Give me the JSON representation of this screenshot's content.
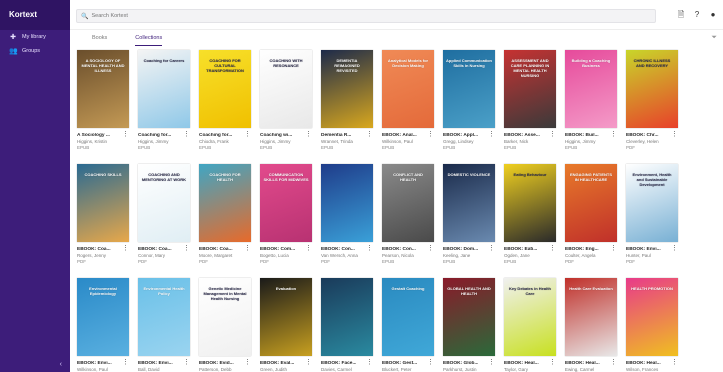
{
  "app": {
    "brand": "Kortext"
  },
  "sidebar": {
    "items": [
      {
        "label": "My library",
        "icon": "library-icon"
      },
      {
        "label": "Groups",
        "icon": "groups-icon"
      }
    ],
    "collapse_icon": "chevron-left-icon"
  },
  "search": {
    "placeholder": "Search Kortext",
    "value": ""
  },
  "header_icons": [
    "bookmark-icon",
    "help-icon",
    "account-icon"
  ],
  "tabs": [
    {
      "label": "Books",
      "active": false
    },
    {
      "label": "Collections",
      "active": true
    }
  ],
  "filter_icon": "filter-icon",
  "books": [
    {
      "title": "A Sociology ...",
      "author": "Higgins, Kristin",
      "format": "EPUB",
      "cover": "A SOCIOLOGY OF MENTAL HEALTH AND ILLNESS",
      "c1": "#6a4e2c",
      "c2": "#c49a55"
    },
    {
      "title": "Coaching for...",
      "author": "Higgins, Jimmy",
      "format": "EPUB",
      "cover": "Coaching for Careers",
      "c1": "#f4f4f4",
      "c2": "#8fc8e8"
    },
    {
      "title": "Coaching for...",
      "author": "Chiodra, Frank",
      "format": "EPUB",
      "cover": "COACHING FOR CULTURAL TRANSFORMATION",
      "c1": "#f7e02a",
      "c2": "#f0c000"
    },
    {
      "title": "Coaching wi...",
      "author": "Higgins, Jimmy",
      "format": "EPUB",
      "cover": "COACHING WITH RESONANCE",
      "c1": "#ffffff",
      "c2": "#e8e8e8"
    },
    {
      "title": "Dementia R...",
      "author": "Wrannet, Trinda",
      "format": "EPUB",
      "cover": "DEMENTIA REIMAGINED REVISITED",
      "c1": "#1d2a4a",
      "c2": "#d9a81e"
    },
    {
      "title": "EBOOK: Anal...",
      "author": "Wilkinson, Paul",
      "format": "EPUB",
      "cover": "Analytical Models for Decision Making",
      "c1": "#f08a56",
      "c2": "#e46a3a"
    },
    {
      "title": "EBOOK: Appl...",
      "author": "Gregg, Lindsey",
      "format": "EPUB",
      "cover": "Applied Communication Skills in Nursing",
      "c1": "#1f6ea0",
      "c2": "#4ba0c8"
    },
    {
      "title": "EBOOK: Asse...",
      "author": "Barker, Nick",
      "format": "EPUB",
      "cover": "ASSESSMENT AND CARE PLANNING IN MENTAL HEALTH NURSING",
      "c1": "#c63232",
      "c2": "#3a3a3a"
    },
    {
      "title": "EBOOK: Buil...",
      "author": "Higgins, Jimmy",
      "format": "EPUB",
      "cover": "Building a Coaching Business",
      "c1": "#e64a9b",
      "c2": "#f49bc8"
    },
    {
      "title": "EBOOK: Chr...",
      "author": "Cleverley, Helen",
      "format": "PDF",
      "cover": "CHRONIC ILLNESS AND RECOVERY",
      "c1": "#c8d62a",
      "c2": "#e8402a"
    },
    {
      "title": "EBOOK: Coa...",
      "author": "Rogers, Jenny",
      "format": "PDF",
      "cover": "COACHING SKILLS",
      "c1": "#2a6a92",
      "c2": "#e8a84a"
    },
    {
      "title": "EBOOK: Coa...",
      "author": "Connor, Mary",
      "format": "PDF",
      "cover": "COACHING AND MENTORING AT WORK",
      "c1": "#ffffff",
      "c2": "#e0eef4"
    },
    {
      "title": "EBOOK: Coa...",
      "author": "Moore, Margaret",
      "format": "PDF",
      "cover": "COACHING FOR HEALTH",
      "c1": "#3fa6c4",
      "c2": "#e86a2a"
    },
    {
      "title": "EBOOK: Com...",
      "author": "Bogetto, Lucia",
      "format": "PDF",
      "cover": "COMMUNICATION SKILLS FOR MIDWIVES",
      "c1": "#e24a8c",
      "c2": "#b83272"
    },
    {
      "title": "EBOOK: Con...",
      "author": "Van Wersch, Anna",
      "format": "PDF",
      "cover": "",
      "c1": "#1f3c8a",
      "c2": "#3aa0d8"
    },
    {
      "title": "EBOOK: Con...",
      "author": "Pearson, Nicola",
      "format": "EPUB",
      "cover": "CONFLICT AND HEALTH",
      "c1": "#8a8a8a",
      "c2": "#4a4a4a"
    },
    {
      "title": "EBOOK: Dom...",
      "author": "Keeling, Jane",
      "format": "EPUB",
      "cover": "DOMESTIC VIOLENCE",
      "c1": "#1a2a4a",
      "c2": "#6a8ab0"
    },
    {
      "title": "EBOOK: Eati...",
      "author": "Ogden, Jane",
      "format": "EPUB",
      "cover": "Eating Behaviour",
      "c1": "#f0d020",
      "c2": "#2a2a2a"
    },
    {
      "title": "EBOOK: Eng...",
      "author": "Coulter, Angela",
      "format": "PDF",
      "cover": "ENGAGING PATIENTS IN HEALTHCARE",
      "c1": "#e87a2a",
      "c2": "#c0302a"
    },
    {
      "title": "EBOOK: Envi...",
      "author": "Hunter, Paul",
      "format": "PDF",
      "cover": "Environment, Health and Sustainable Development",
      "c1": "#ffffff",
      "c2": "#78b0d4"
    },
    {
      "title": "EBOOK: Envi...",
      "author": "Wilkinson, Paul",
      "format": "PDF",
      "cover": "Environmental Epidemiology",
      "c1": "#2a8ac8",
      "c2": "#5ab0e0"
    },
    {
      "title": "EBOOK: Envi...",
      "author": "Ball, David",
      "format": "PDF",
      "cover": "Environmental Health Policy",
      "c1": "#6ac0e8",
      "c2": "#9ad4f0"
    },
    {
      "title": "EBOOK: Evid...",
      "author": "Patterson, Debb",
      "format": "PDF",
      "cover": "Genetic Medicine Management in Mental Health Nursing",
      "c1": "#ffffff",
      "c2": "#f0f0f0"
    },
    {
      "title": "EBOOK: Eval...",
      "author": "Green, Judith",
      "format": "PDF",
      "cover": "Evaluation",
      "c1": "#1a1a1a",
      "c2": "#c8a020"
    },
    {
      "title": "EBOOK: Face...",
      "author": "Davies, Carmel",
      "format": "PDF",
      "cover": "",
      "c1": "#1a3a5a",
      "c2": "#2a8aa0"
    },
    {
      "title": "EBOOK: Gest...",
      "author": "Bluckert, Peter",
      "format": "PDF",
      "cover": "Gestalt Coaching",
      "c1": "#2a8ac0",
      "c2": "#40a8d8"
    },
    {
      "title": "EBOOK: Glob...",
      "author": "Parkhurst, Justin",
      "format": "PDF",
      "cover": "GLOBAL HEALTH AND HEALTH",
      "c1": "#8a1a2a",
      "c2": "#2a6a3a"
    },
    {
      "title": "EBOOK: Heal...",
      "author": "Taylor, Gary",
      "format": "PDF",
      "cover": "Key Debates in Health Care",
      "c1": "#f0f0f0",
      "c2": "#c8e020"
    },
    {
      "title": "EBOOK: Heal...",
      "author": "Ewing, Carmel",
      "format": "PDF",
      "cover": "Health Care Evaluation",
      "c1": "#c0302a",
      "c2": "#e8e8e8"
    },
    {
      "title": "EBOOK: Heal...",
      "author": "Wilson, Frances",
      "format": "PDF",
      "cover": "HEALTH PROMOTION",
      "c1": "#e83a8a",
      "c2": "#f0c020"
    }
  ]
}
